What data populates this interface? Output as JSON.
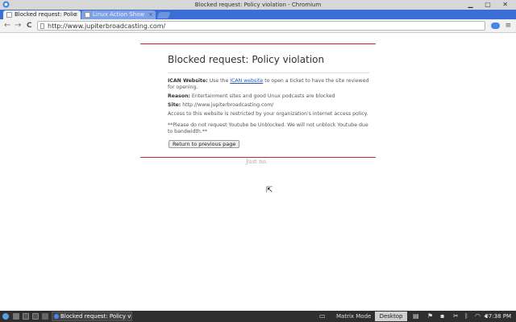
{
  "window": {
    "title": "Blocked request: Policy violation - Chromium",
    "buttons": "▁ ▢ ✕"
  },
  "tabs": [
    {
      "label": "Blocked request: Polic",
      "close": "×"
    },
    {
      "label": "Linux Action Show",
      "close": "×"
    }
  ],
  "toolbar": {
    "back": "←",
    "forward": "→",
    "reload": "C",
    "url": "http://www.jupiterbroadcasting.com/",
    "menu": "≡"
  },
  "page": {
    "heading": "Blocked request: Policy violation",
    "icann_label": "ICAN Website:",
    "icann_pre": "Use the",
    "icann_link": "ICAN website",
    "icann_post": "to open a ticket to have the site reviewed for opening.",
    "reason_label": "Reason:",
    "reason_text": "Entertainment sites and good Unux podcasts are blocked",
    "site_label": "Site:",
    "site_text": "http://www.jupiterbroadcasting.com/",
    "restricted_text": "Access to this website is restricted by your organization's internet access policy.",
    "youtube_note": "**Please do not request Youtube be Unblocked. We will not unblock Youtube due to bandwidth.**",
    "return_button": "Return to previous page",
    "just_no": "Just no."
  },
  "taskbar": {
    "task_label": "Blocked request: Policy viola",
    "matrix_mode": "Matrix Mode",
    "desktop": "Desktop",
    "clock": "07:38 PM",
    "tray_icons": [
      "network-icon",
      "notes-icon",
      "flag-icon",
      "scissors-icon",
      "wifi-icon",
      "volume-icon"
    ]
  },
  "cursor": "⇱"
}
